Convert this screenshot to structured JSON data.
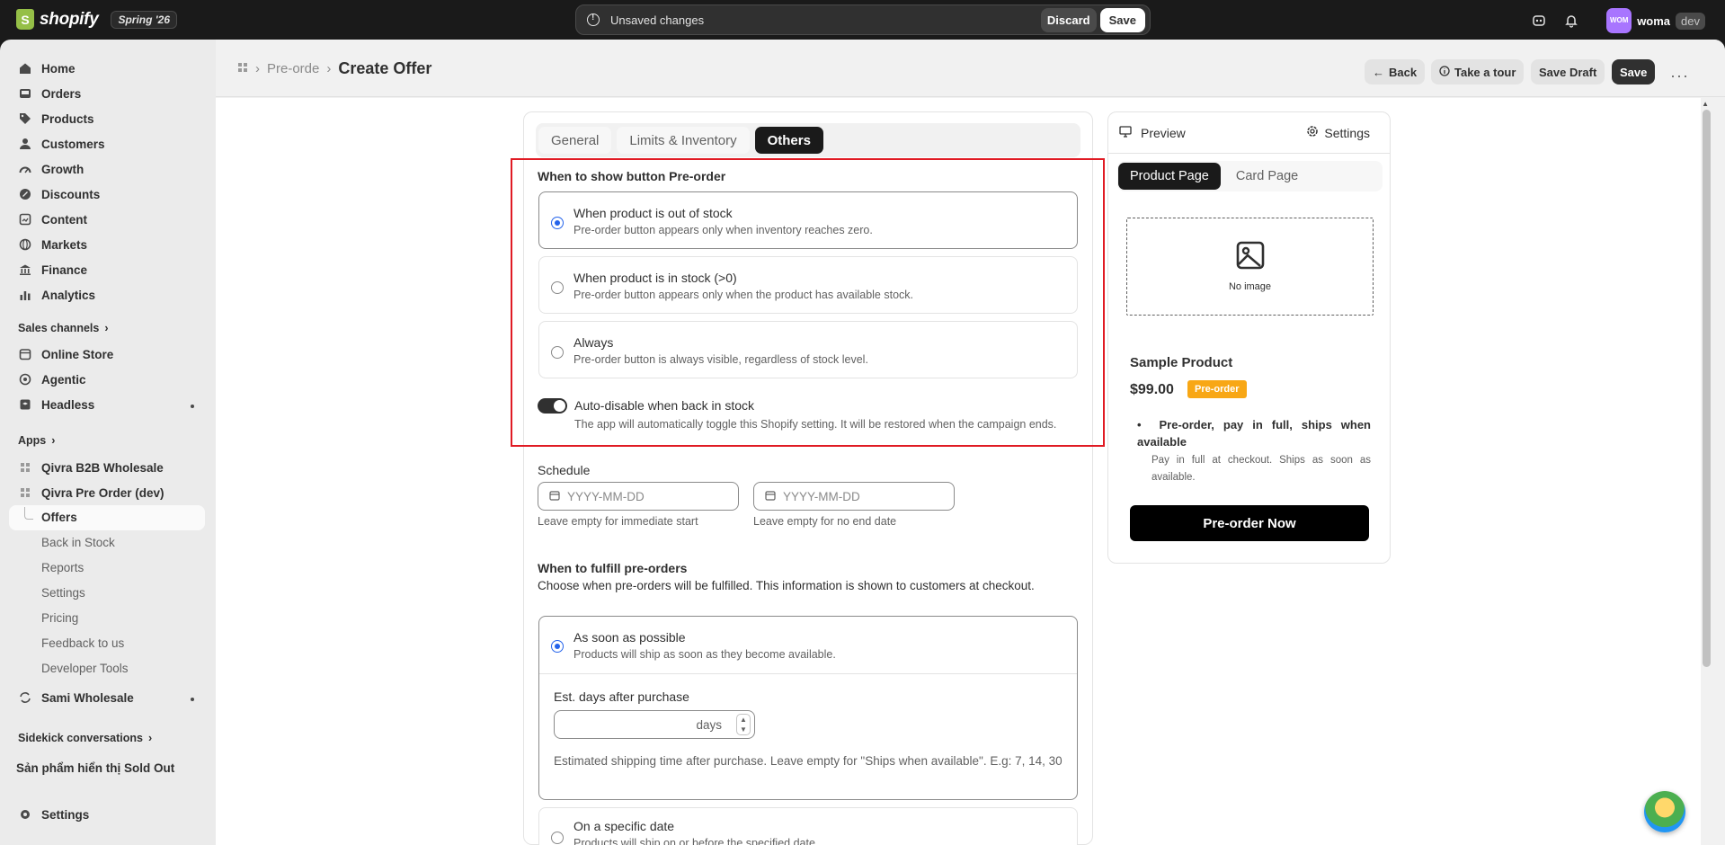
{
  "topbar": {
    "logo_text": "shopify",
    "version": "Spring '26",
    "unsaved": "Unsaved changes",
    "discard": "Discard",
    "save": "Save",
    "avatar": "WOM",
    "user": "woma",
    "user_badge": "dev"
  },
  "sidebar": {
    "main": [
      "Home",
      "Orders",
      "Products",
      "Customers",
      "Growth",
      "Discounts",
      "Content",
      "Markets",
      "Finance",
      "Analytics"
    ],
    "sales_channels_label": "Sales channels",
    "channels": [
      "Online Store",
      "Agentic",
      "Headless"
    ],
    "apps_label": "Apps",
    "apps": [
      "Qivra B2B Wholesale",
      "Qivra Pre Order (dev)"
    ],
    "app_sub": [
      "Offers",
      "Back in Stock",
      "Reports",
      "Settings",
      "Pricing",
      "Feedback to us",
      "Developer Tools"
    ],
    "sami": "Sami Wholesale",
    "sidekick_label": "Sidekick conversations",
    "sidekick_item": "Sản phẩm hiển thị Sold Out",
    "settings": "Settings"
  },
  "header": {
    "crumb_parent": "Pre-orde",
    "title": "Create Offer",
    "back": "Back",
    "tour": "Take a tour",
    "save_draft": "Save Draft",
    "save": "Save"
  },
  "form": {
    "tabs": [
      "General",
      "Limits & Inventory",
      "Others"
    ],
    "show_label": "When to show button Pre-order",
    "options": [
      {
        "title": "When product is out of stock",
        "desc": "Pre-order button appears only when inventory reaches zero."
      },
      {
        "title": "When product is in stock (>0)",
        "desc": "Pre-order button appears only when the product has available stock."
      },
      {
        "title": "Always",
        "desc": "Pre-order button is always visible, regardless of stock level."
      }
    ],
    "toggle_title": "Auto-disable when back in stock",
    "toggle_desc": "The app will automatically toggle this Shopify setting. It will be restored when the campaign ends.",
    "schedule_label": "Schedule",
    "date_placeholder": "YYYY-MM-DD",
    "start_help": "Leave empty for immediate start",
    "end_help": "Leave empty for no end date",
    "fulfill_label": "When to fulfill pre-orders",
    "fulfill_desc": "Choose when pre-orders will be fulfilled. This information is shown to customers at checkout.",
    "asap_title": "As soon as possible",
    "asap_desc": "Products will ship as soon as they become available.",
    "est_label": "Est. days after purchase",
    "days_suffix": "days",
    "est_help": "Estimated shipping time after purchase. Leave empty for \"Ships when available\". E.g: 7, 14, 30",
    "specific_title": "On a specific date",
    "specific_desc": "Products will ship on or before the specified date."
  },
  "preview": {
    "title": "Preview",
    "settings": "Settings",
    "tabs": [
      "Product Page",
      "Card Page"
    ],
    "no_image": "No image",
    "product_name": "Sample Product",
    "price": "$99.00",
    "badge": "Pre-order",
    "bullet_title": "Pre-order, pay in full, ships when available",
    "bullet_desc": "Pay in full at checkout. Ships as soon as available.",
    "button": "Pre-order Now"
  },
  "colors": {
    "accent_radio": "#2463eb",
    "badge": "#f8a715",
    "highlight_box": "#e01b24"
  }
}
